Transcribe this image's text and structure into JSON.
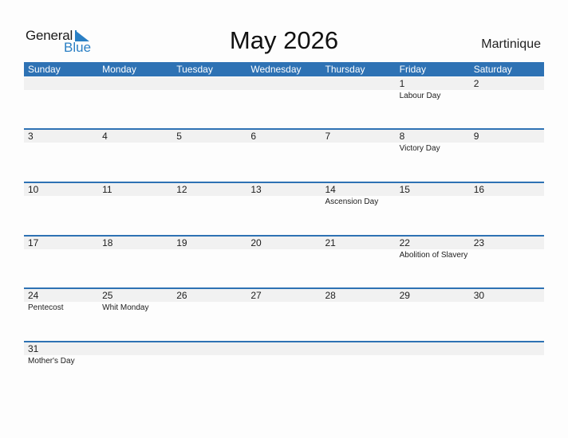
{
  "logo": {
    "line1": "General",
    "line2": "Blue"
  },
  "title": "May 2026",
  "country": "Martinique",
  "colors": {
    "accent": "#2e72b4",
    "logo_blue": "#2a7fc4",
    "strip": "#f1f1f1"
  },
  "days_of_week": [
    "Sunday",
    "Monday",
    "Tuesday",
    "Wednesday",
    "Thursday",
    "Friday",
    "Saturday"
  ],
  "weeks": [
    [
      {
        "day": "",
        "holiday": ""
      },
      {
        "day": "",
        "holiday": ""
      },
      {
        "day": "",
        "holiday": ""
      },
      {
        "day": "",
        "holiday": ""
      },
      {
        "day": "",
        "holiday": ""
      },
      {
        "day": "1",
        "holiday": "Labour Day"
      },
      {
        "day": "2",
        "holiday": ""
      }
    ],
    [
      {
        "day": "3",
        "holiday": ""
      },
      {
        "day": "4",
        "holiday": ""
      },
      {
        "day": "5",
        "holiday": ""
      },
      {
        "day": "6",
        "holiday": ""
      },
      {
        "day": "7",
        "holiday": ""
      },
      {
        "day": "8",
        "holiday": "Victory Day"
      },
      {
        "day": "9",
        "holiday": ""
      }
    ],
    [
      {
        "day": "10",
        "holiday": ""
      },
      {
        "day": "11",
        "holiday": ""
      },
      {
        "day": "12",
        "holiday": ""
      },
      {
        "day": "13",
        "holiday": ""
      },
      {
        "day": "14",
        "holiday": "Ascension Day"
      },
      {
        "day": "15",
        "holiday": ""
      },
      {
        "day": "16",
        "holiday": ""
      }
    ],
    [
      {
        "day": "17",
        "holiday": ""
      },
      {
        "day": "18",
        "holiday": ""
      },
      {
        "day": "19",
        "holiday": ""
      },
      {
        "day": "20",
        "holiday": ""
      },
      {
        "day": "21",
        "holiday": ""
      },
      {
        "day": "22",
        "holiday": "Abolition of Slavery"
      },
      {
        "day": "23",
        "holiday": ""
      }
    ],
    [
      {
        "day": "24",
        "holiday": "Pentecost"
      },
      {
        "day": "25",
        "holiday": "Whit Monday"
      },
      {
        "day": "26",
        "holiday": ""
      },
      {
        "day": "27",
        "holiday": ""
      },
      {
        "day": "28",
        "holiday": ""
      },
      {
        "day": "29",
        "holiday": ""
      },
      {
        "day": "30",
        "holiday": ""
      }
    ],
    [
      {
        "day": "31",
        "holiday": "Mother's Day"
      },
      {
        "day": "",
        "holiday": ""
      },
      {
        "day": "",
        "holiday": ""
      },
      {
        "day": "",
        "holiday": ""
      },
      {
        "day": "",
        "holiday": ""
      },
      {
        "day": "",
        "holiday": ""
      },
      {
        "day": "",
        "holiday": ""
      }
    ]
  ]
}
